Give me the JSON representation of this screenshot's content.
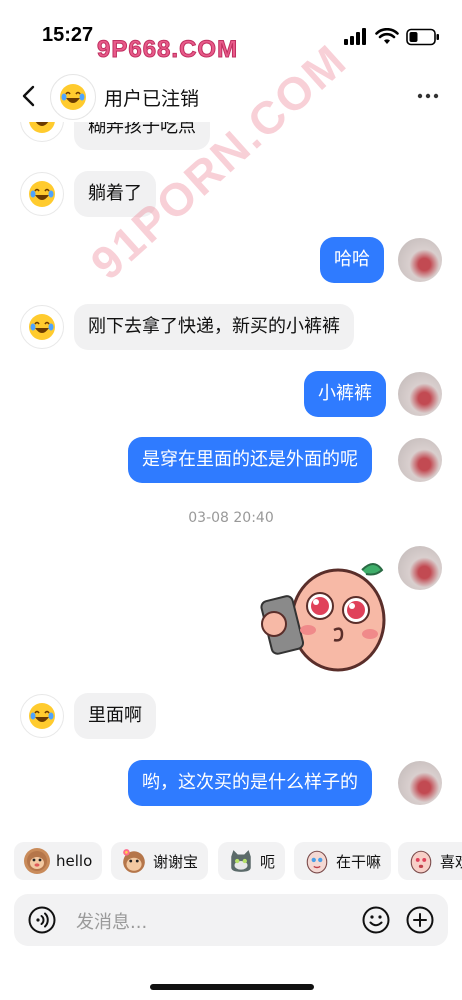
{
  "status": {
    "time": "15:27",
    "watermark": "9P668.COM"
  },
  "header": {
    "title": "用户已注销"
  },
  "messages": {
    "m0": "糊弄孩子吃点",
    "m1": "躺着了",
    "m2": "哈哈",
    "m3": "刚下去拿了快递，新买的小裤裤",
    "m4": "小裤裤",
    "m5": "是穿在里面的还是外面的呢",
    "timestamp": "03-08 20:40",
    "m6": "里面啊",
    "m7": "哟，这次买的是什么样子的"
  },
  "watermark_diag": "91PORN.COM",
  "quick_replies": [
    {
      "label": "hello",
      "icon": "monkey-icon"
    },
    {
      "label": "谢谢宝",
      "icon": "monkey-flower-icon"
    },
    {
      "label": "呃",
      "icon": "cat-icon"
    },
    {
      "label": "在干嘛",
      "icon": "doll-icon"
    },
    {
      "label": "喜欢",
      "icon": "doll-pink-icon"
    }
  ],
  "input": {
    "placeholder": "发消息..."
  },
  "colors": {
    "accent": "#2f7bff",
    "incoming": "#f1f1f2"
  }
}
